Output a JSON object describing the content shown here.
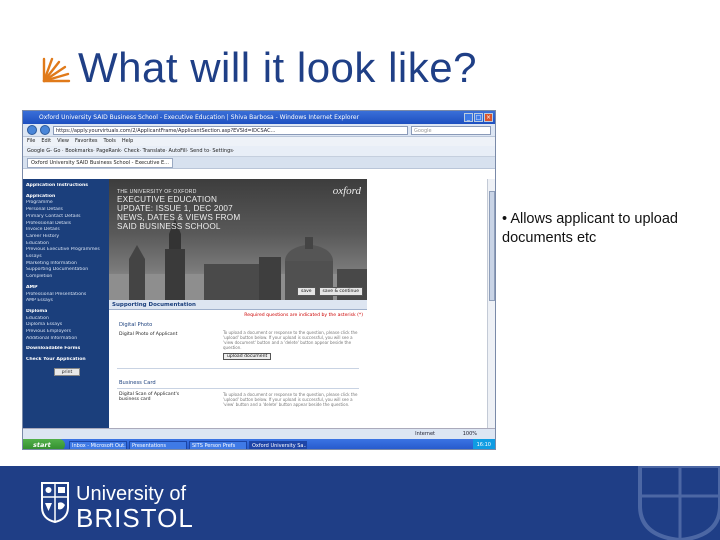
{
  "slide": {
    "title": "What will it look like?",
    "bullet": "Allows applicant to upload documents etc"
  },
  "browser": {
    "window_title": "Oxford University SAID Business School - Executive Education | Shiva Barbosa - Windows Internet Explorer",
    "address_url": "https://apply.yourvirtuals.com/2/ApplicantFrame/ApplicantSection.asp?EVSId=IDCSAC...",
    "search_placeholder": "Google",
    "menu": [
      "File",
      "Edit",
      "View",
      "Favorites",
      "Tools",
      "Help"
    ],
    "toolbar_text": "Google  G-   Go  ·  Bookmarks·  PageRank·  Check·  Translate·  AutoFill·  Send to·  Settings·",
    "tab_label": "Oxford University SAID Business School - Executive E...",
    "status_zone": "Internet",
    "status_zoom": "100%"
  },
  "sidebar": {
    "items": [
      {
        "label": "Application Instructions",
        "heading": true
      },
      {
        "label": "Application",
        "heading": true
      },
      {
        "label": "Programme",
        "heading": false
      },
      {
        "label": "Personal Details",
        "heading": false
      },
      {
        "label": "Primary Contact Details",
        "heading": false
      },
      {
        "label": "Professional Details",
        "heading": false
      },
      {
        "label": "Invoice Details",
        "heading": false
      },
      {
        "label": "Career History",
        "heading": false
      },
      {
        "label": "Education",
        "heading": false
      },
      {
        "label": "Previous Executive Programmes",
        "heading": false
      },
      {
        "label": "Essays",
        "heading": false
      },
      {
        "label": "Marketing Information",
        "heading": false
      },
      {
        "label": "Supporting Documentation",
        "heading": false
      },
      {
        "label": "Completion",
        "heading": false
      },
      {
        "label": "AMP",
        "heading": true
      },
      {
        "label": "Professional Presentations",
        "heading": false
      },
      {
        "label": "AMP Essays",
        "heading": false
      },
      {
        "label": "Diploma",
        "heading": true
      },
      {
        "label": "Education",
        "heading": false
      },
      {
        "label": "Diploma Essays",
        "heading": false
      },
      {
        "label": "Previous Employers",
        "heading": false
      },
      {
        "label": "Additional Information",
        "heading": false
      },
      {
        "label": "Downloadable Forms",
        "heading": true
      },
      {
        "label": "Check Your Application",
        "heading": true
      }
    ],
    "print_label": "print"
  },
  "banner": {
    "line_small": "THE UNIVERSITY OF OXFORD",
    "line1": "EXECUTIVE EDUCATION",
    "line2": "UPDATE: ISSUE 1, DEC 2007",
    "line3": "NEWS, DATES & VIEWS FROM",
    "line4": "SAID BUSINESS SCHOOL",
    "logo": "oxford",
    "save_label": "save",
    "save_continue_label": "save & continue"
  },
  "content": {
    "section_title": "Supporting Documentation",
    "required_note": "Required questions are indicated by the asterisk (*)",
    "digital_photo_heading": "Digital Photo",
    "digital_photo_label": "Digital Photo of Applicant",
    "upload_note": "To upload a document or response to the question, please click the 'upload' button below. If your upload is successful, you will see a 'view document' button and a 'delete' button appear beside the question.",
    "upload_button": "upload document",
    "business_card_heading": "Business Card",
    "business_card_label": "Digital Scan of Applicant's business card",
    "upload_note_2": "To upload a document or response to the question, please click the 'upload' button below. If your upload is successful, you will see a 'view' button and a 'delete' button appear beside the question."
  },
  "taskbar": {
    "start_label": "start",
    "items": [
      "Inbox - Microsoft Out...",
      "Presentations",
      "SITS Person Prefs",
      "Oxford University Sa..."
    ],
    "clock": "16:10"
  },
  "footer": {
    "line1": "University of",
    "line2": "BRISTOL"
  },
  "colors": {
    "title_blue": "#1f3f86",
    "footer_blue": "#1f3e86",
    "sidebar_blue": "#1b3f7c"
  }
}
